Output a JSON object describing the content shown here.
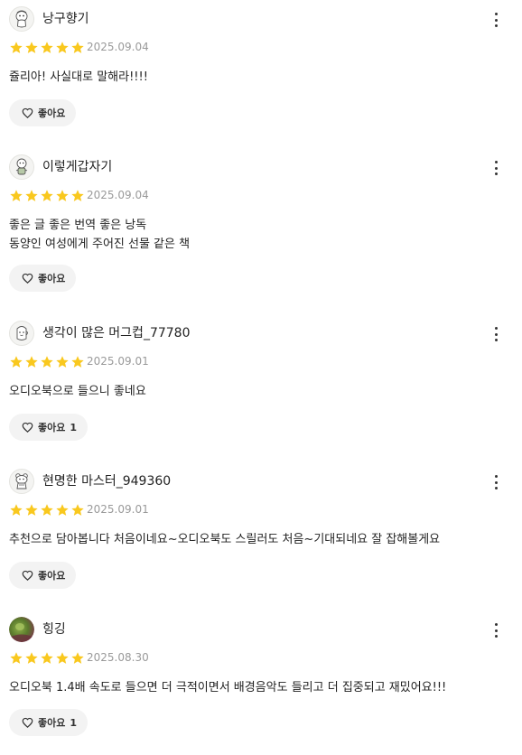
{
  "colors": {
    "star": "#f9c81e",
    "date": "#9a9a9a",
    "button_bg": "#f3f3f3",
    "text": "#222222"
  },
  "reviews": [
    {
      "username": "낭구향기",
      "avatar_icon": "character-avatar-icon",
      "rating": 5,
      "date": "2025.09.04",
      "lines": [
        "쥴리아! 사실대로 말해라!!!!"
      ],
      "like_label": "좋아요",
      "like_count": ""
    },
    {
      "username": "이렇게갑자기",
      "avatar_icon": "character-avatar-icon",
      "rating": 5,
      "date": "2025.09.04",
      "lines": [
        "좋은 글 좋은 번역 좋은 낭독",
        "동양인 여성에게 주어진 선물 같은 책"
      ],
      "like_label": "좋아요",
      "like_count": ""
    },
    {
      "username": "생각이 많은 머그컵_77780",
      "avatar_icon": "character-avatar-icon",
      "rating": 5,
      "date": "2025.09.01",
      "lines": [
        "오디오북으로 들으니 좋네요"
      ],
      "like_label": "좋아요",
      "like_count": "1"
    },
    {
      "username": "현명한 마스터_949360",
      "avatar_icon": "character-avatar-icon",
      "rating": 5,
      "date": "2025.09.01",
      "lines": [
        "추천으로 담아봅니다 처음이네요~오디오북도 스릴러도 처음~기대되네요 잘 잡해볼게요"
      ],
      "like_label": "좋아요",
      "like_count": ""
    },
    {
      "username": "힝깅",
      "avatar_icon": "photo-avatar-icon",
      "rating": 5,
      "date": "2025.08.30",
      "lines": [
        "오디오북 1.4배 속도로 들으면 더 극적이면서 배경음악도 들리고 더 집중되고 재밌어요!!!"
      ],
      "like_label": "좋아요",
      "like_count": "1"
    }
  ]
}
